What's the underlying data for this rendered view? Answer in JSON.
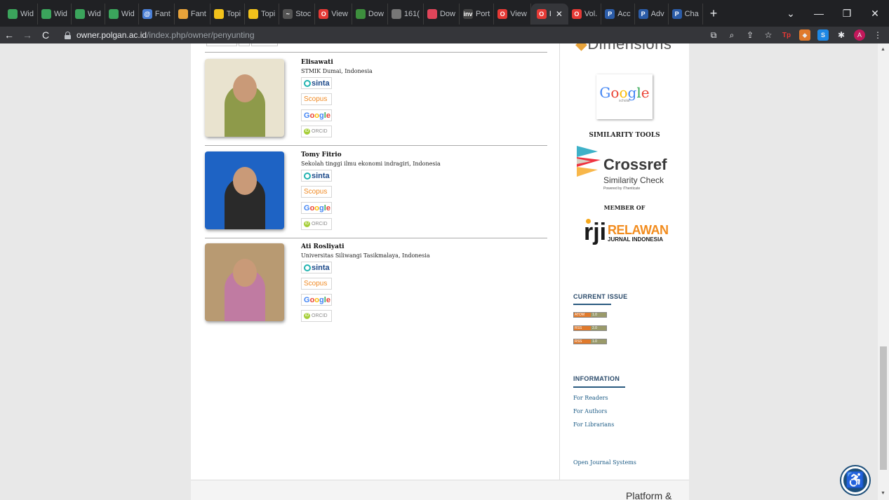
{
  "browser": {
    "tabs": [
      {
        "label": "Wid",
        "color": "#3ba55c",
        "glyph": ""
      },
      {
        "label": "Wid",
        "color": "#3ba55c",
        "glyph": ""
      },
      {
        "label": "Wid",
        "color": "#3ba55c",
        "glyph": ""
      },
      {
        "label": "Wid",
        "color": "#3ba55c",
        "glyph": ""
      },
      {
        "label": "Fant",
        "color": "#4a7fd6",
        "glyph": "@"
      },
      {
        "label": "Fant",
        "color": "#e8a33a",
        "glyph": ""
      },
      {
        "label": "Topi",
        "color": "#f2c21b",
        "glyph": ""
      },
      {
        "label": "Topi",
        "color": "#f2c21b",
        "glyph": ""
      },
      {
        "label": "Stoc",
        "color": "#555555",
        "glyph": "~"
      },
      {
        "label": "View",
        "color": "#e53935",
        "glyph": "O"
      },
      {
        "label": "Dow",
        "color": "#3d8f3d",
        "glyph": ""
      },
      {
        "label": "161(",
        "color": "#777777",
        "glyph": ""
      },
      {
        "label": "Dow",
        "color": "#e0455a",
        "glyph": ""
      },
      {
        "label": "Port",
        "color": "#444444",
        "glyph": "inv"
      },
      {
        "label": "View",
        "color": "#e53935",
        "glyph": "O"
      },
      {
        "label": "I",
        "color": "#e53935",
        "glyph": "O",
        "active": true
      },
      {
        "label": "Vol.",
        "color": "#e53935",
        "glyph": "O"
      },
      {
        "label": "Acc",
        "color": "#2b5ca8",
        "glyph": "P"
      },
      {
        "label": "Adv",
        "color": "#2b5ca8",
        "glyph": "P"
      },
      {
        "label": "Cha",
        "color": "#2b5ca8",
        "glyph": "P"
      }
    ],
    "url_host": "owner.polgan.ac.id",
    "url_path": "/index.php/owner/penyunting"
  },
  "editors": [
    {
      "name": "Elisawati",
      "affiliation": "STMIK Dumai, Indonesia",
      "photo_bg": "#e9e3cf",
      "photo_fg": "#8e9a4a"
    },
    {
      "name": "Tomy Fitrio",
      "affiliation": "Sekolah tinggi ilmu ekonomi indragiri, Indonesia",
      "photo_bg": "#1e63c4",
      "photo_fg": "#2a2a2a"
    },
    {
      "name": "Ati Rosliyati",
      "affiliation": "Universitas Siliwangi Tasikmalaya, Indonesia",
      "photo_bg": "#b89a72",
      "photo_fg": "#c07ba2"
    }
  ],
  "badges": {
    "sinta": "sinta",
    "scopus": "Scopus",
    "google": "Google",
    "orcid": "ORCID"
  },
  "sidebar": {
    "dimensions_text": "Dimensions",
    "google_scholar": "Google",
    "google_scholar_sub": "scholar",
    "similarity_tools": "SIMILARITY TOOLS",
    "crossref_title": "Crossref",
    "crossref_sub": "Similarity Check",
    "crossref_powered": "Powered by iThenticate",
    "member_of": "MEMBER OF",
    "relawan_title": "RELAWAN",
    "relawan_sub": "JURNAL INDONESIA",
    "current_issue": "CURRENT ISSUE",
    "feeds": [
      {
        "left": "ATOM",
        "right": "1.0"
      },
      {
        "left": "RSS",
        "right": "2.0"
      },
      {
        "left": "RSS",
        "right": "1.0"
      }
    ],
    "information": "INFORMATION",
    "info_links": [
      "For Readers",
      "For Authors",
      "For Librarians"
    ],
    "ojs": "Open Journal Systems"
  },
  "footer": {
    "platform": "Platform &"
  }
}
